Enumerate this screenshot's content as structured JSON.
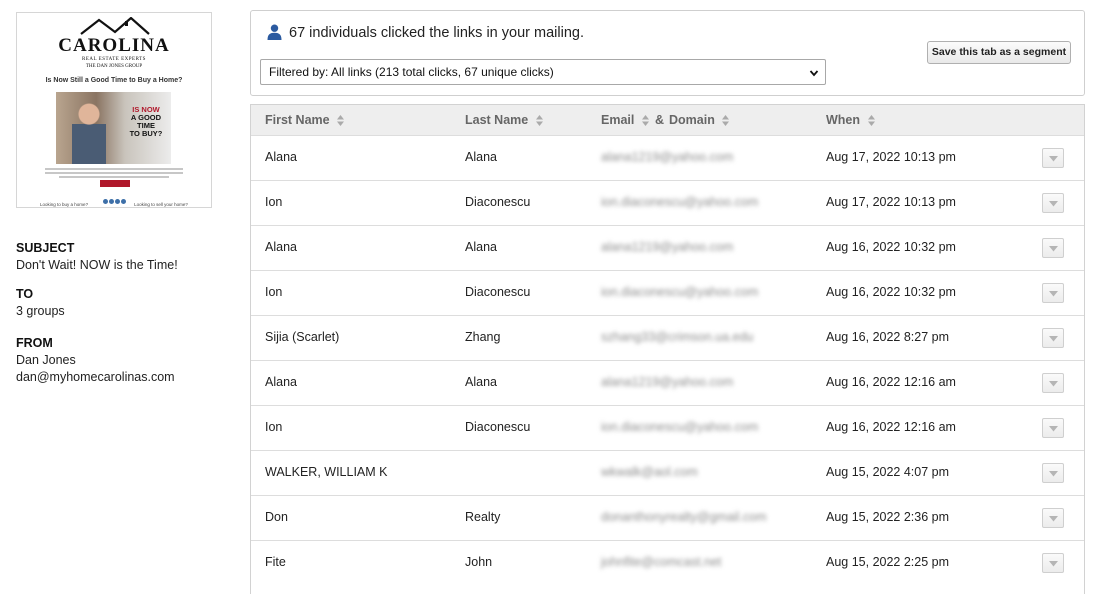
{
  "preview": {
    "logo_main": "CAROLINA",
    "logo_sub": "REAL ESTATE EXPERTS",
    "logo_sub2": "THE DAN JONES GROUP",
    "headline": "Is Now Still a Good Time to Buy a Home?",
    "hero_line1": "IS NOW",
    "hero_line2": "A GOOD",
    "hero_line3": "TIME",
    "hero_line4": "TO BUY?",
    "footer_left": "Looking to buy a home?",
    "footer_right": "Looking to sell your home?"
  },
  "meta": {
    "subject_label": "SUBJECT",
    "subject_value": "Don't Wait! NOW is the Time!",
    "to_label": "TO",
    "to_value": "3 groups",
    "from_label": "FROM",
    "from_name": "Dan Jones",
    "from_email": "dan@myhomecarolinas.com"
  },
  "summary": {
    "icon": "user-icon",
    "text": "67 individuals clicked the links in your mailing.",
    "filter_value": "Filtered by: All links (213 total clicks, 67 unique clicks)",
    "segment_button": "Save this tab as a segment"
  },
  "table": {
    "headers": {
      "first_name": "First Name",
      "last_name": "Last Name",
      "email": "Email",
      "amp": "&",
      "domain": "Domain",
      "when": "When"
    },
    "rows": [
      {
        "first": "Alana",
        "last": "Alana",
        "email": "alana1219@yahoo.com",
        "when": "Aug 17, 2022 10:13 pm"
      },
      {
        "first": "Ion",
        "last": "Diaconescu",
        "email": "ion.diaconescu@yahoo.com",
        "when": "Aug 17, 2022 10:13 pm"
      },
      {
        "first": "Alana",
        "last": "Alana",
        "email": "alana1219@yahoo.com",
        "when": "Aug 16, 2022 10:32 pm"
      },
      {
        "first": "Ion",
        "last": "Diaconescu",
        "email": "ion.diaconescu@yahoo.com",
        "when": "Aug 16, 2022 10:32 pm"
      },
      {
        "first": "Sijia (Scarlet)",
        "last": "Zhang",
        "email": "szhang33@crimson.ua.edu",
        "when": "Aug 16, 2022 8:27 pm"
      },
      {
        "first": "Alana",
        "last": "Alana",
        "email": "alana1219@yahoo.com",
        "when": "Aug 16, 2022 12:16 am"
      },
      {
        "first": "Ion",
        "last": "Diaconescu",
        "email": "ion.diaconescu@yahoo.com",
        "when": "Aug 16, 2022 12:16 am"
      },
      {
        "first": "WALKER, WILLIAM K",
        "last": "",
        "email": "wkwalk@aol.com",
        "when": "Aug 15, 2022 4:07 pm"
      },
      {
        "first": "Don",
        "last": "Realty",
        "email": "donanthonyrealty@gmail.com",
        "when": "Aug 15, 2022 2:36 pm"
      },
      {
        "first": "Fite",
        "last": "John",
        "email": "johnfite@comcast.net",
        "when": "Aug 15, 2022 2:25 pm"
      }
    ]
  },
  "colors": {
    "accent_icon": "#2b5aa0",
    "brand_red": "#b0182b",
    "header_bg": "#eeeeee"
  }
}
